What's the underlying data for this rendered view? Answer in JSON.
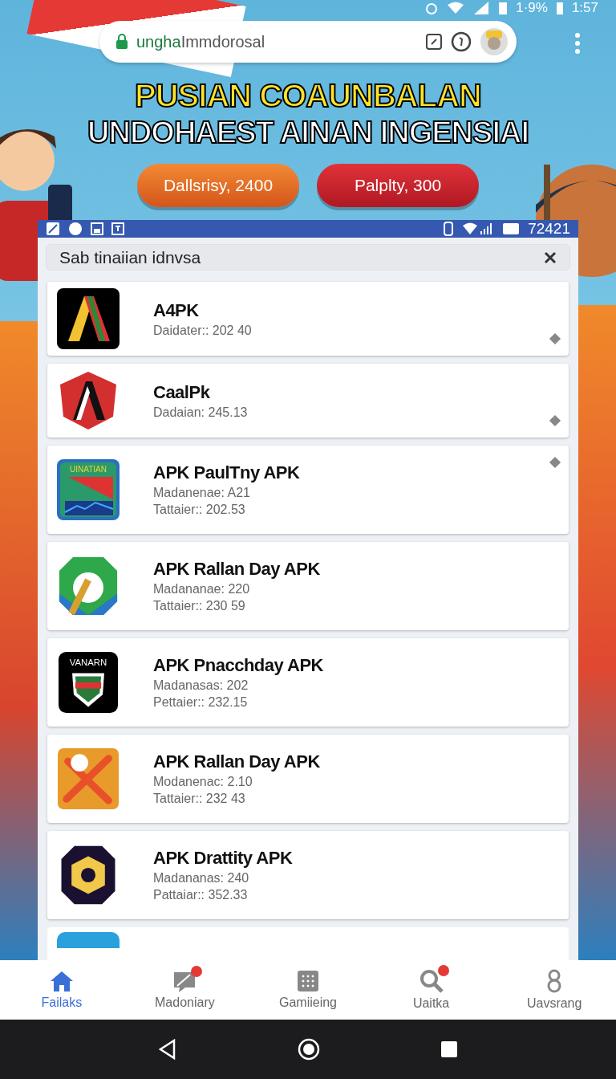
{
  "status_bar": {
    "battery": "1·9%",
    "time": "1:57"
  },
  "browser": {
    "url_host": "ungha",
    "url_path": "Immdorosal"
  },
  "banner": {
    "headline": [
      "PUSIAN COAUNBALAN",
      "UNDOHAEST AINAN INGENSIAI"
    ],
    "buttons": [
      {
        "label": "Dallsrisy, 2400",
        "kind": "orange"
      },
      {
        "label": "Palplty, 300",
        "kind": "red"
      }
    ]
  },
  "inner_status": {
    "time": "72421"
  },
  "search": {
    "value": "Sab tinaiian idnvsa"
  },
  "apps": [
    {
      "title": "A4PK",
      "lines": [
        "Daidater:: 202 40"
      ],
      "kind": "stripes",
      "marked": true
    },
    {
      "title": "CaalPk",
      "lines": [
        "Dadaian: 245.13"
      ],
      "kind": "shield",
      "marked": true
    },
    {
      "title": "APK PaulTny APK",
      "lines": [
        "Madanenae: A21",
        "Tattaier:: 202.53"
      ],
      "kind": "flag",
      "icon_text": "UINATIAN",
      "marked": true
    },
    {
      "title": "APK Rallan Day APK",
      "lines": [
        "Madananae: 220",
        "Tattaier:: 230 59"
      ],
      "kind": "ring",
      "marked": false
    },
    {
      "title": "APK Pnacchday APK",
      "lines": [
        "Madanasas: 202",
        "Pettaier:: 232.15"
      ],
      "kind": "badge",
      "icon_text": "VANARN",
      "marked": false
    },
    {
      "title": "APK Rallan Day APK",
      "lines": [
        "Modanenac: 2.10",
        "Tattaier:: 232 43"
      ],
      "kind": "cross",
      "marked": false
    },
    {
      "title": "APK Drattity APK",
      "lines": [
        "Madananas: 240",
        "Pattaiar:: 352.33"
      ],
      "kind": "gear",
      "marked": false
    }
  ],
  "bottom_nav": [
    {
      "label": "Failaks",
      "kind": "home",
      "selected": true,
      "badge": false
    },
    {
      "label": "Madoniary",
      "kind": "chat",
      "selected": false,
      "badge": true
    },
    {
      "label": "Gamiieing",
      "kind": "grid",
      "selected": false,
      "badge": false
    },
    {
      "label": "Uaitka",
      "kind": "search",
      "selected": false,
      "badge": true
    },
    {
      "label": "Uavsrang",
      "kind": "eight",
      "selected": false,
      "badge": false
    }
  ]
}
